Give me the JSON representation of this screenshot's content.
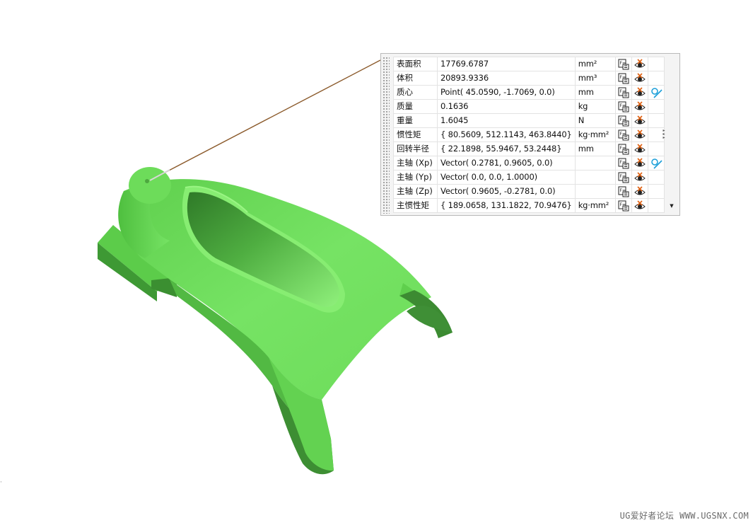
{
  "measurements": [
    {
      "name": "表面积",
      "value": "17769.6787",
      "unit": "mm²",
      "extra_icon": ""
    },
    {
      "name": "体积",
      "value": "20893.9336",
      "unit": "mm³",
      "extra_icon": ""
    },
    {
      "name": "质心",
      "value": "Point( 45.0590, -1.7069, 0.0)",
      "unit": "mm",
      "extra_icon": "point-vector-icon"
    },
    {
      "name": "质量",
      "value": "0.1636",
      "unit": "kg",
      "extra_icon": ""
    },
    {
      "name": "重量",
      "value": "1.6045",
      "unit": "N",
      "extra_icon": ""
    },
    {
      "name": "惯性矩",
      "value": "{ 80.5609, 512.1143, 463.8440}",
      "unit": "kg·mm²",
      "extra_icon": ""
    },
    {
      "name": "回转半径",
      "value": "{ 22.1898, 55.9467, 53.2448}",
      "unit": "mm",
      "extra_icon": ""
    },
    {
      "name": "主轴 (Xp)",
      "value": "Vector( 0.2781, 0.9605, 0.0)",
      "unit": "",
      "extra_icon": "point-vector-icon"
    },
    {
      "name": "主轴 (Yp)",
      "value": "Vector( 0.0, 0.0, 1.0000)",
      "unit": "",
      "extra_icon": ""
    },
    {
      "name": "主轴 (Zp)",
      "value": "Vector( 0.9605, -0.2781, 0.0)",
      "unit": "",
      "extra_icon": ""
    },
    {
      "name": "主惯性矩",
      "value": "{ 189.0658, 131.1822, 70.9476}",
      "unit": "kg·mm²",
      "extra_icon": ""
    }
  ],
  "row_icons": [
    "export-expression-icon",
    "show-hide-icon"
  ],
  "model": {
    "part_color": "#6fdc5a",
    "dark_color": "#3f8f36",
    "leader_color": "#8b5a2b"
  },
  "watermark": {
    "site_cn": "UG爱好者论坛",
    "site_url": "WWW.UGSNX.COM"
  }
}
